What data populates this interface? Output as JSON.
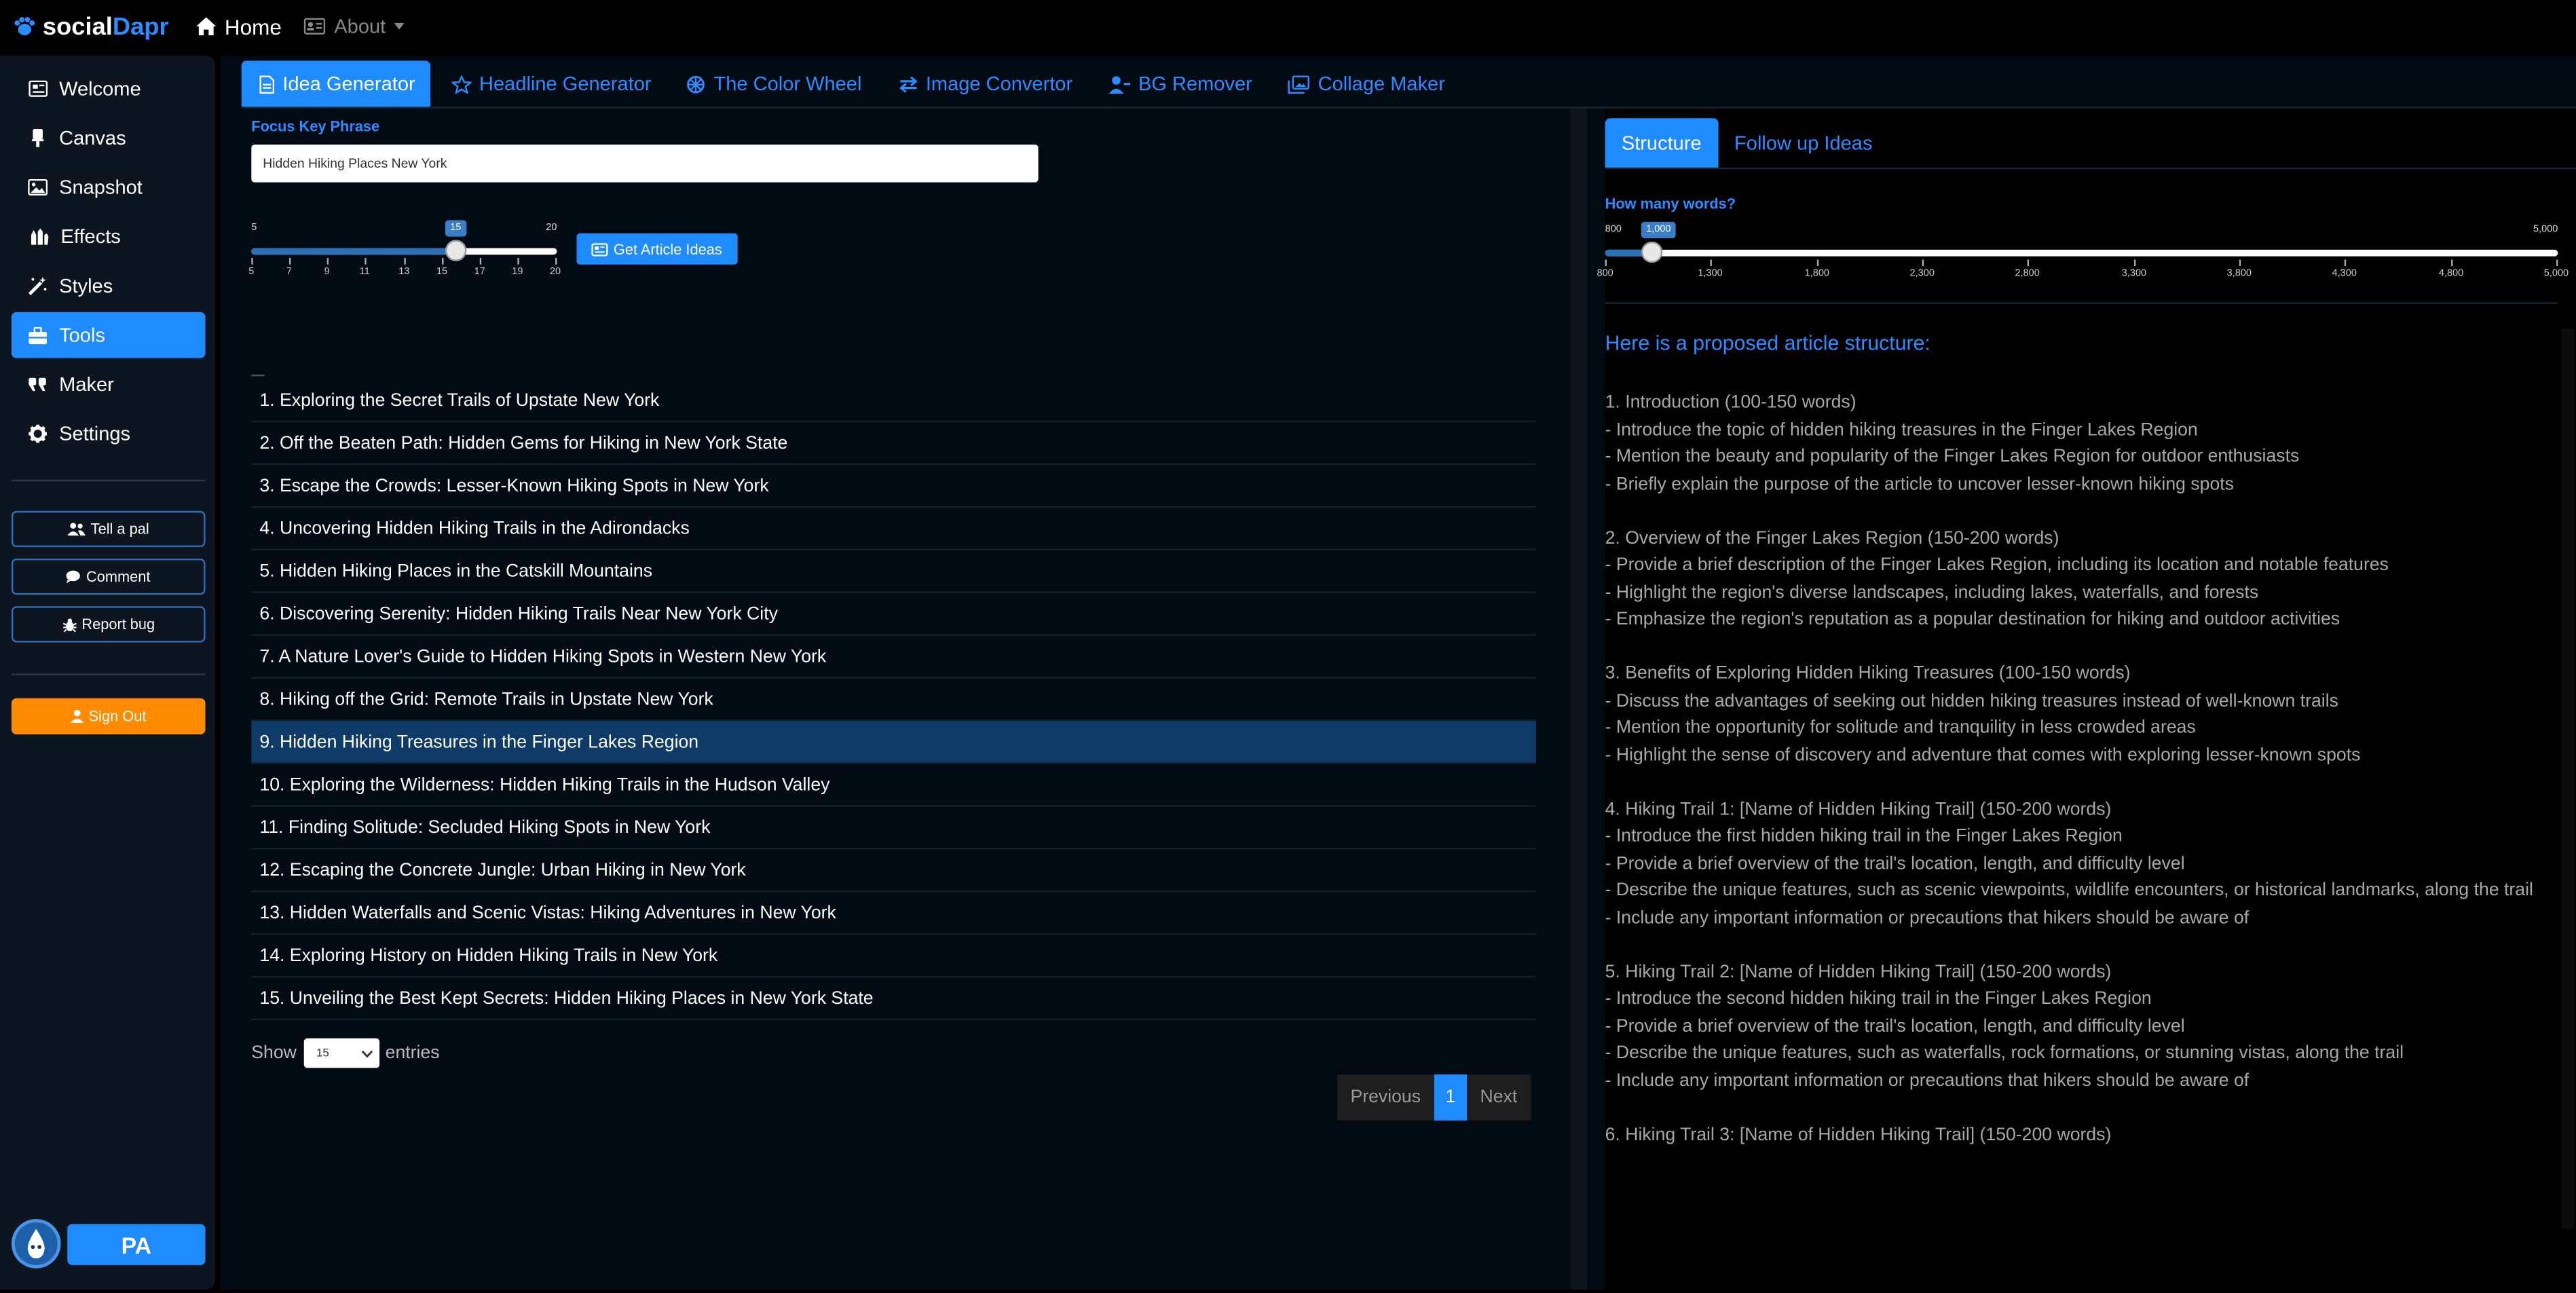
{
  "topbar": {
    "brand_prefix": "social",
    "brand_suffix": "Dapr",
    "home_label": "Home",
    "about_label": "About"
  },
  "sidebar": {
    "items": [
      {
        "label": "Welcome",
        "icon": "newspaper-icon"
      },
      {
        "label": "Canvas",
        "icon": "brush-icon"
      },
      {
        "label": "Snapshot",
        "icon": "image-icon"
      },
      {
        "label": "Effects",
        "icon": "hands-icon"
      },
      {
        "label": "Styles",
        "icon": "magic-wand-icon"
      },
      {
        "label": "Tools",
        "icon": "toolbox-icon",
        "active": true
      },
      {
        "label": "Maker",
        "icon": "quote-icon"
      },
      {
        "label": "Settings",
        "icon": "gear-icon"
      }
    ],
    "buttons": {
      "tell_a_pal": "Tell a pal",
      "comment": "Comment",
      "report_bug": "Report bug"
    },
    "sign_out": "Sign Out",
    "user_initials": "PA"
  },
  "tabs": [
    {
      "label": "Idea Generator",
      "icon": "file-icon",
      "active": true
    },
    {
      "label": "Headline Generator",
      "icon": "star-icon"
    },
    {
      "label": "The Color Wheel",
      "icon": "color-wheel-icon"
    },
    {
      "label": "Image Convertor",
      "icon": "arrows-exchange-icon"
    },
    {
      "label": "BG Remover",
      "icon": "user-minus-icon"
    },
    {
      "label": "Collage Maker",
      "icon": "images-icon"
    }
  ],
  "idea_generator": {
    "focus_label": "Focus Key Phrase",
    "focus_value": "Hidden Hiking Places New York",
    "ideas_slider": {
      "min": "5",
      "max": "20",
      "value": "15",
      "value_fraction": 0.6667,
      "ticks": [
        "5",
        "7",
        "9",
        "11",
        "13",
        "15",
        "17",
        "19",
        "20"
      ]
    },
    "get_ideas_label": "Get Article Ideas",
    "ideas": [
      "1. Exploring the Secret Trails of Upstate New York",
      "2. Off the Beaten Path: Hidden Gems for Hiking in New York State",
      "3. Escape the Crowds: Lesser-Known Hiking Spots in New York",
      "4. Uncovering Hidden Hiking Trails in the Adirondacks",
      "5. Hidden Hiking Places in the Catskill Mountains",
      "6. Discovering Serenity: Hidden Hiking Trails Near New York City",
      "7. A Nature Lover's Guide to Hidden Hiking Spots in Western New York",
      "8. Hiking off the Grid: Remote Trails in Upstate New York",
      "9. Hidden Hiking Treasures in the Finger Lakes Region",
      "10. Exploring the Wilderness: Hidden Hiking Trails in the Hudson Valley",
      "11. Finding Solitude: Secluded Hiking Spots in New York",
      "12. Escaping the Concrete Jungle: Urban Hiking in New York",
      "13. Hidden Waterfalls and Scenic Vistas: Hiking Adventures in New York",
      "14. Exploring History on Hidden Hiking Trails in New York",
      "15. Unveiling the Best Kept Secrets: Hidden Hiking Places in New York State"
    ],
    "selected_index": 8,
    "show_label": "Show",
    "entries_value": "15",
    "entries_label": "entries",
    "pager": {
      "previous": "Previous",
      "current": "1",
      "next": "Next"
    }
  },
  "structure_panel": {
    "tabs": [
      {
        "label": "Structure",
        "active": true
      },
      {
        "label": "Follow up Ideas"
      }
    ],
    "words_label": "How many words?",
    "words_slider": {
      "min": "800",
      "max": "5,000",
      "value": "1,000",
      "value_fraction": 0.0476,
      "ticks": [
        "800",
        "1,300",
        "1,800",
        "2,300",
        "2,800",
        "3,300",
        "3,800",
        "4,300",
        "4,800",
        "5,000"
      ]
    },
    "title": "Here is a proposed article structure:",
    "lines": [
      "1. Introduction (100-150 words)",
      "- Introduce the topic of hidden hiking treasures in the Finger Lakes Region",
      "- Mention the beauty and popularity of the Finger Lakes Region for outdoor enthusiasts",
      "- Briefly explain the purpose of the article to uncover lesser-known hiking spots",
      "",
      "2. Overview of the Finger Lakes Region (150-200 words)",
      "- Provide a brief description of the Finger Lakes Region, including its location and notable features",
      "- Highlight the region's diverse landscapes, including lakes, waterfalls, and forests",
      "- Emphasize the region's reputation as a popular destination for hiking and outdoor activities",
      "",
      "3. Benefits of Exploring Hidden Hiking Treasures (100-150 words)",
      "- Discuss the advantages of seeking out hidden hiking treasures instead of well-known trails",
      "- Mention the opportunity for solitude and tranquility in less crowded areas",
      "- Highlight the sense of discovery and adventure that comes with exploring lesser-known spots",
      "",
      "4. Hiking Trail 1: [Name of Hidden Hiking Trail] (150-200 words)",
      "- Introduce the first hidden hiking trail in the Finger Lakes Region",
      "- Provide a brief overview of the trail's location, length, and difficulty level",
      "- Describe the unique features, such as scenic viewpoints, wildlife encounters, or historical landmarks, along the trail",
      "- Include any important information or precautions that hikers should be aware of",
      "",
      "5. Hiking Trail 2: [Name of Hidden Hiking Trail] (150-200 words)",
      "- Introduce the second hidden hiking trail in the Finger Lakes Region",
      "- Provide a brief overview of the trail's location, length, and difficulty level",
      "- Describe the unique features, such as waterfalls, rock formations, or stunning vistas, along the trail",
      "- Include any important information or precautions that hikers should be aware of",
      "",
      "6. Hiking Trail 3: [Name of Hidden Hiking Trail] (150-200 words)"
    ]
  },
  "colors": {
    "accent": "#1e8bff",
    "signout": "#ff8c00",
    "selected_row": "#0f3b68",
    "background": "#000000"
  }
}
